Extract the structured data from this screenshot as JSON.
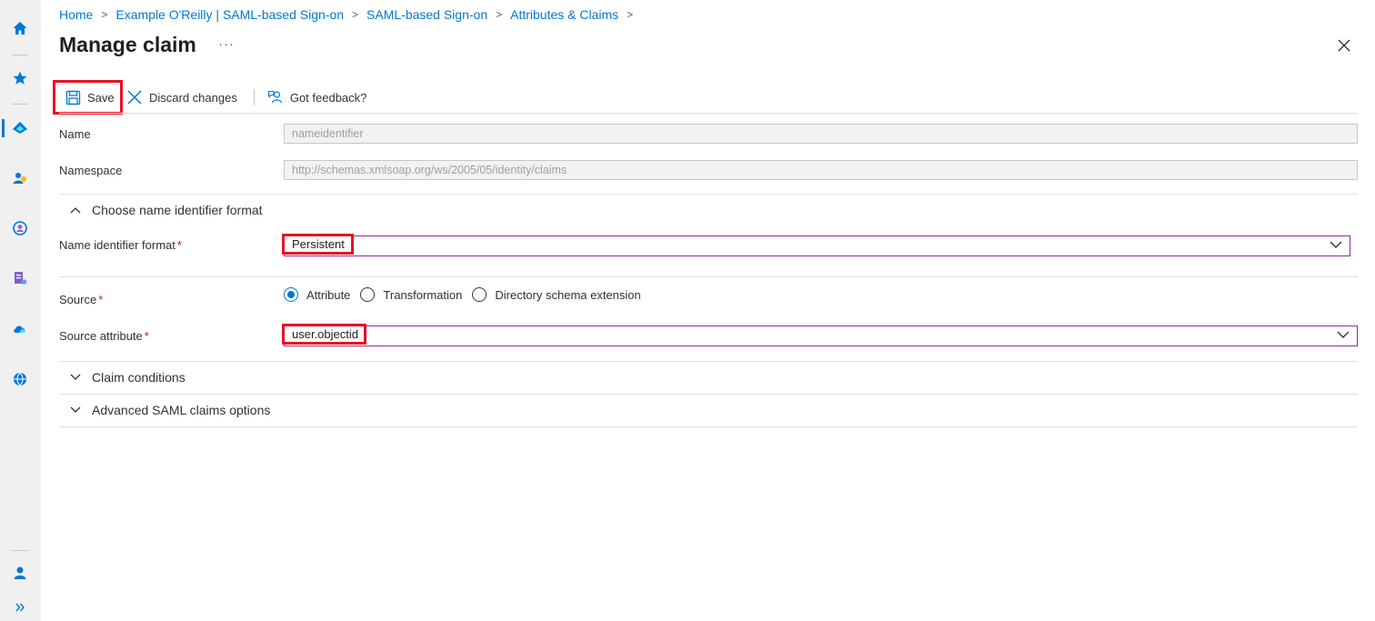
{
  "breadcrumb": {
    "items": [
      "Home",
      "Example O'Reilly | SAML-based Sign-on",
      "SAML-based Sign-on",
      "Attributes & Claims"
    ],
    "separator": ">"
  },
  "page": {
    "title": "Manage claim",
    "more": "···"
  },
  "toolbar": {
    "save_label": "Save",
    "discard_label": "Discard changes",
    "feedback_label": "Got feedback?"
  },
  "form": {
    "name_label": "Name",
    "name_value": "nameidentifier",
    "namespace_label": "Namespace",
    "namespace_value": "http://schemas.xmlsoap.org/ws/2005/05/identity/claims",
    "section_format": "Choose name identifier format",
    "format_label": "Name identifier format",
    "format_value": "Persistent",
    "source_label": "Source",
    "source_options": [
      "Attribute",
      "Transformation",
      "Directory schema extension"
    ],
    "source_selected": "Attribute",
    "source_attr_label": "Source attribute",
    "source_attr_value": "user.objectid",
    "required_mark": "*",
    "section_conditions": "Claim conditions",
    "section_advanced": "Advanced SAML claims options"
  },
  "colors": {
    "accent": "#0078d4",
    "highlight": "#e81123",
    "focus_border": "#8a2d9f",
    "required": "#a4262c"
  },
  "rail": {
    "icons": [
      "home-icon",
      "favorites-icon",
      "azure-ad-icon",
      "users-icon",
      "identity-governance-icon",
      "app-registration-icon",
      "cloud-icon",
      "globe-icon",
      "user-account-icon",
      "expand-icon"
    ]
  }
}
